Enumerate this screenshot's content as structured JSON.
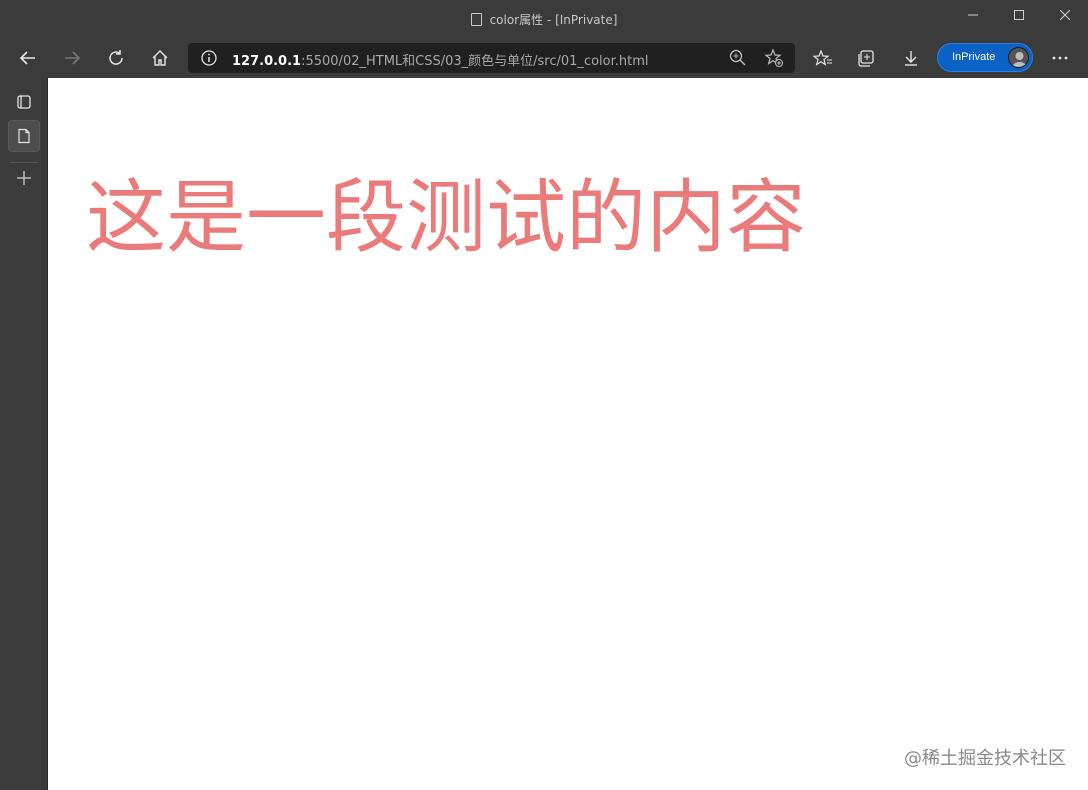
{
  "window": {
    "title": "color属性 - [InPrivate]"
  },
  "toolbar": {
    "url_host": "127.0.0.1",
    "url_rest": ":5500/02_HTML和CSS/03_颜色与单位/src/01_color.html",
    "inprivate_label": "InPrivate"
  },
  "page": {
    "headline": "这是一段测试的内容",
    "headline_color": "#eb7a7a"
  },
  "watermark": "@稀土掘金技术社区",
  "icons": {
    "back": "arrow-left-icon",
    "forward": "arrow-right-icon",
    "refresh": "refresh-icon",
    "home": "home-icon",
    "info": "info-icon",
    "zoom": "zoom-icon",
    "add_favorite": "star-add-icon",
    "favorites": "favorites-icon",
    "collections": "collections-icon",
    "downloads": "download-icon",
    "more": "more-icon",
    "tabs": "tab-actions-icon",
    "page": "page-icon",
    "new_tab": "plus-icon"
  }
}
